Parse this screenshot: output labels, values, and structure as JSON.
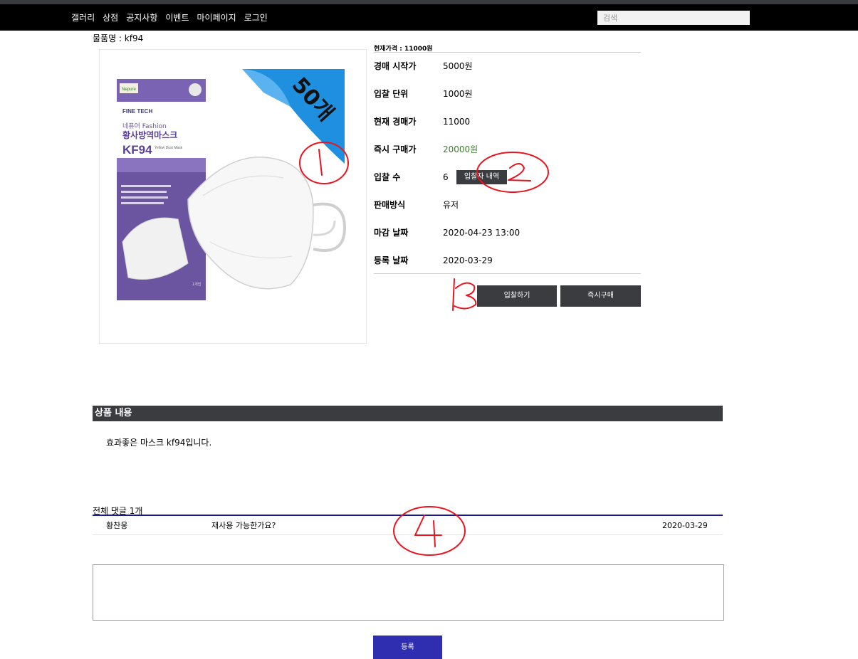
{
  "nav": {
    "items": [
      "갤러리",
      "상점",
      "공지사항",
      "이벤트",
      "마이페이지",
      "로그인"
    ],
    "search_placeholder": "검색"
  },
  "product": {
    "name_line": "물품명 : kf94",
    "current_price_line": "현재가격 : 11000원",
    "image": {
      "ribbon_text": "50개",
      "brand_tag": "Nepure",
      "maker": "FINE TECH",
      "line1": "네퓨어 Fashion",
      "line2": "황사방역마스크",
      "kf_label": "KF94",
      "sub_label": "Yellow Dust Mask",
      "count_label": "1개입",
      "colors": {
        "box_purple": "#6b55a0",
        "ribbon_blue": "#1f8fe0"
      }
    }
  },
  "details": [
    {
      "label": "경매 시작가",
      "value": "5000원"
    },
    {
      "label": "입찰 단위",
      "value": "1000원"
    },
    {
      "label": "현재 경매가",
      "value": "11000"
    },
    {
      "label": "즉시 구매가",
      "value": "20000원",
      "color": "#3a7f2a"
    },
    {
      "label": "입찰 수",
      "value": "6",
      "button": "입찰자 내역"
    },
    {
      "label": "판매방식",
      "value": "유저"
    },
    {
      "label": "마감 날짜",
      "value": "2020-04-23 13:00"
    },
    {
      "label": "등록 날짜",
      "value": "2020-03-29"
    }
  ],
  "actions": {
    "bid": "입찰하기",
    "buy_now": "즉시구매"
  },
  "section": {
    "title": "상품 내용",
    "description": "효과좋은 마스크 kf94입니다."
  },
  "comments": {
    "count_label": "전체 댓글 1개",
    "items": [
      {
        "author": "황찬웅",
        "text": "재사용 가능한가요?",
        "date": "2020-03-29"
      }
    ],
    "input_placeholder": "",
    "submit": "등록"
  },
  "annotations": {
    "marks": [
      "1",
      "2",
      "3",
      "4"
    ],
    "color": "#e8141e"
  }
}
